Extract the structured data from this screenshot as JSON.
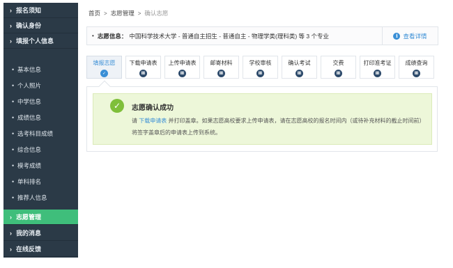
{
  "sidebar": {
    "items": [
      {
        "label": "报名须知",
        "kind": "top"
      },
      {
        "label": "确认身份",
        "kind": "top"
      },
      {
        "label": "填报个人信息",
        "kind": "top"
      },
      {
        "label": "基本信息",
        "kind": "sub"
      },
      {
        "label": "个人照片",
        "kind": "sub"
      },
      {
        "label": "中学信息",
        "kind": "sub"
      },
      {
        "label": "成绩信息",
        "kind": "sub"
      },
      {
        "label": "选考科目成绩",
        "kind": "sub"
      },
      {
        "label": "综合信息",
        "kind": "sub"
      },
      {
        "label": "模考成绩",
        "kind": "sub"
      },
      {
        "label": "单科排名",
        "kind": "sub"
      },
      {
        "label": "推荐人信息",
        "kind": "sub"
      },
      {
        "label": "志愿管理",
        "kind": "top",
        "active": true
      },
      {
        "label": "我的消息",
        "kind": "top"
      },
      {
        "label": "在线反馈",
        "kind": "top"
      }
    ]
  },
  "breadcrumb": {
    "home": "首页",
    "section": "志愿管理",
    "current": "确认志愿",
    "separator": ">"
  },
  "infobar": {
    "bullet": "•",
    "label": "志愿信息：",
    "value": "中国科学技术大学 - 普通自主招生 - 普通自主 - 物理学类(理科类) 等 3 个专业",
    "detail_link": "查看详情",
    "detail_icon": "i"
  },
  "steps": [
    {
      "label": "填报志愿",
      "icon": "✓",
      "active": true
    },
    {
      "label": "下载申请表",
      "icon": "Ⅲ"
    },
    {
      "label": "上传申请表",
      "icon": "Ⅲ"
    },
    {
      "label": "邮寄材料",
      "icon": "Ⅲ"
    },
    {
      "label": "学校审核",
      "icon": "Ⅲ"
    },
    {
      "label": "确认考试",
      "icon": "Ⅲ"
    },
    {
      "label": "交费",
      "icon": "Ⅲ"
    },
    {
      "label": "打印准考证",
      "icon": "Ⅲ"
    },
    {
      "label": "成绩查询",
      "icon": "Ⅲ"
    }
  ],
  "success": {
    "icon": "✓",
    "title": "志愿确认成功",
    "msg_before": "请 ",
    "msg_link": "下载申请表",
    "msg_after": " 并打印盖章。如果志愿高校要求上传申请表，请在志愿高校的报名时间内（或待补充材料的截止时间前）将签字盖章后的申请表上传到系统。"
  },
  "colors": {
    "sidebar_bg": "#2b3a47",
    "sidebar_active": "#3fbe7b",
    "accent_blue": "#3a8fd6",
    "success_bg": "#edf7d9",
    "success_check": "#7fbf3a"
  }
}
